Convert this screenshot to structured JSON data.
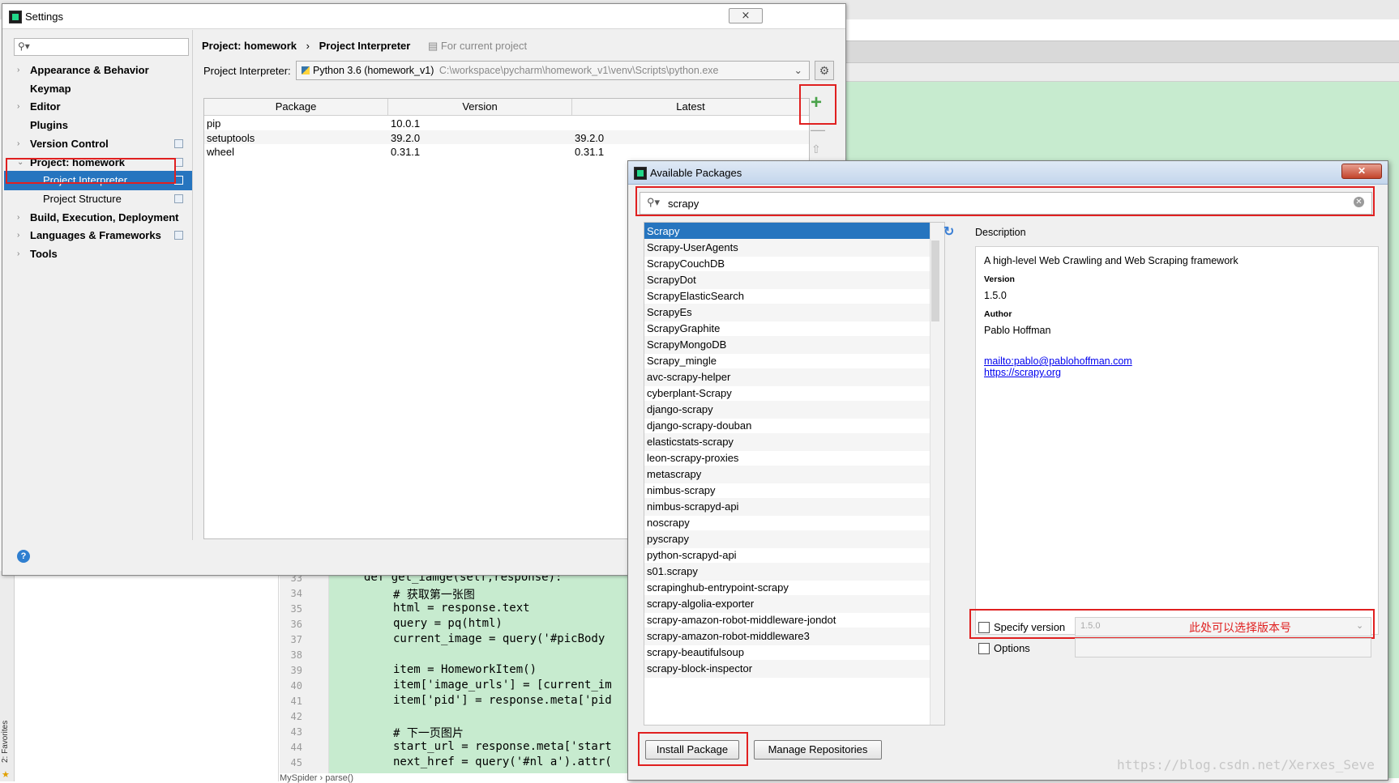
{
  "ide": {
    "favorites": "2: Favorites",
    "code_lines": [
      {
        "n": "33",
        "t": "def get_iamge(self,response):"
      },
      {
        "n": "34",
        "t": "# 获取第一张图"
      },
      {
        "n": "35",
        "t": "html = response.text"
      },
      {
        "n": "36",
        "t": "query = pq(html)"
      },
      {
        "n": "37",
        "t": "current_image = query('#picBody"
      },
      {
        "n": "38",
        "t": ""
      },
      {
        "n": "39",
        "t": "item = HomeworkItem()"
      },
      {
        "n": "40",
        "t": "item['image_urls'] = [current_im"
      },
      {
        "n": "41",
        "t": "item['pid'] = response.meta['pid"
      },
      {
        "n": "42",
        "t": ""
      },
      {
        "n": "43",
        "t": "# 下一页图片"
      },
      {
        "n": "44",
        "t": "start_url = response.meta['start"
      },
      {
        "n": "45",
        "t": "next_href = query('#nl a').attr("
      }
    ],
    "status": "MySpider  ›  parse()"
  },
  "settings": {
    "title": "Settings",
    "close": "⨯",
    "sidebar": [
      {
        "label": "Appearance & Behavior",
        "arrow": "›",
        "bold": true,
        "indent": 0,
        "cfg": false
      },
      {
        "label": "Keymap",
        "arrow": "",
        "bold": true,
        "indent": 0,
        "cfg": false
      },
      {
        "label": "Editor",
        "arrow": "›",
        "bold": true,
        "indent": 0,
        "cfg": false
      },
      {
        "label": "Plugins",
        "arrow": "",
        "bold": true,
        "indent": 0,
        "cfg": false
      },
      {
        "label": "Version Control",
        "arrow": "›",
        "bold": true,
        "indent": 0,
        "cfg": true
      },
      {
        "label": "Project: homework",
        "arrow": "⌄",
        "bold": true,
        "indent": 0,
        "cfg": true
      },
      {
        "label": "Project Interpreter",
        "arrow": "",
        "bold": false,
        "indent": 1,
        "cfg": true,
        "selected": true
      },
      {
        "label": "Project Structure",
        "arrow": "",
        "bold": false,
        "indent": 1,
        "cfg": true
      },
      {
        "label": "Build, Execution, Deployment",
        "arrow": "›",
        "bold": true,
        "indent": 0,
        "cfg": false
      },
      {
        "label": "Languages & Frameworks",
        "arrow": "›",
        "bold": true,
        "indent": 0,
        "cfg": true
      },
      {
        "label": "Tools",
        "arrow": "›",
        "bold": true,
        "indent": 0,
        "cfg": false
      }
    ],
    "breadcrumb": {
      "project": "Project: homework",
      "sep": "›",
      "page": "Project Interpreter",
      "scope": "For current project"
    },
    "interpreter": {
      "label": "Project Interpreter:",
      "name": "Python 3.6 (homework_v1)",
      "path": "C:\\workspace\\pycharm\\homework_v1\\venv\\Scripts\\python.exe"
    },
    "table": {
      "headers": [
        "Package",
        "Version",
        "Latest"
      ],
      "rows": [
        [
          "pip",
          "10.0.1",
          ""
        ],
        [
          "setuptools",
          "39.2.0",
          "39.2.0"
        ],
        [
          "wheel",
          "0.31.1",
          "0.31.1"
        ]
      ]
    },
    "help": "?",
    "add": "+",
    "remove": "—",
    "up": "⇧"
  },
  "available": {
    "title": "Available Packages",
    "close": "✕",
    "search_value": "scrapy",
    "packages": [
      "Scrapy",
      "Scrapy-UserAgents",
      "ScrapyCouchDB",
      "ScrapyDot",
      "ScrapyElasticSearch",
      "ScrapyEs",
      "ScrapyGraphite",
      "ScrapyMongoDB",
      "Scrapy_mingle",
      "avc-scrapy-helper",
      "cyberplant-Scrapy",
      "django-scrapy",
      "django-scrapy-douban",
      "elasticstats-scrapy",
      "leon-scrapy-proxies",
      "metascrapy",
      "nimbus-scrapy",
      "nimbus-scrapyd-api",
      "noscrapy",
      "pyscrapy",
      "python-scrapyd-api",
      "s01.scrapy",
      "scrapinghub-entrypoint-scrapy",
      "scrapy-algolia-exporter",
      "scrapy-amazon-robot-middleware-jondot",
      "scrapy-amazon-robot-middleware3",
      "scrapy-beautifulsoup",
      "scrapy-block-inspector"
    ],
    "selected_index": 0,
    "description": {
      "label": "Description",
      "summary": "A high-level Web Crawling and Web Scraping framework",
      "version_label": "Version",
      "version": "1.5.0",
      "author_label": "Author",
      "author": "Pablo Hoffman",
      "email_link": "mailto:pablo@pablohoffman.com",
      "site_link": "https://scrapy.org"
    },
    "specify_version_label": "Specify version",
    "specify_version_value": "1.5.0",
    "annotation": "此处可以选择版本号",
    "options_label": "Options",
    "install_button": "Install Package",
    "manage_button": "Manage Repositories"
  },
  "watermark": "https://blog.csdn.net/Xerxes_Seve",
  "colors": {
    "selection": "#2675bf",
    "highlight_red": "#e02020",
    "code_bg": "#c7ebcf"
  }
}
